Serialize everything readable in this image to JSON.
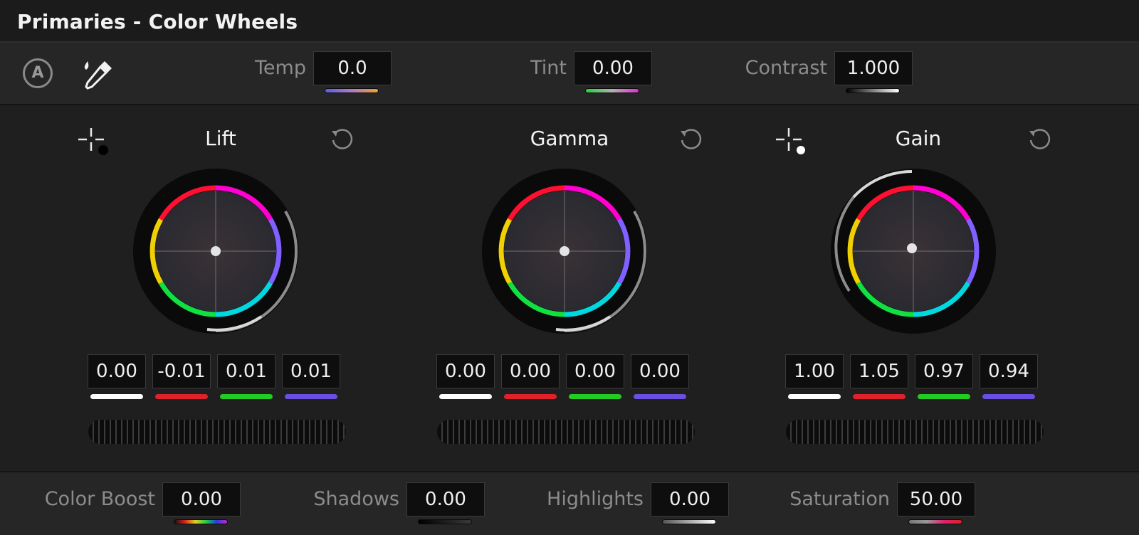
{
  "title": "Primaries - Color Wheels",
  "toolbar": {
    "auto_icon": "auto-balance-icon",
    "auto_label": "A",
    "picker_icon": "eyedropper-icon",
    "temp": {
      "label": "Temp",
      "value": "0.0"
    },
    "tint": {
      "label": "Tint",
      "value": "0.00"
    },
    "contrast": {
      "label": "Contrast",
      "value": "1.000"
    }
  },
  "wheels": [
    {
      "name": "Lift",
      "values": [
        "0.00",
        "-0.01",
        "0.01",
        "0.01"
      ]
    },
    {
      "name": "Gamma",
      "values": [
        "0.00",
        "0.00",
        "0.00",
        "0.00"
      ]
    },
    {
      "name": "Gain",
      "values": [
        "1.00",
        "1.05",
        "0.97",
        "0.94"
      ]
    }
  ],
  "channel_colors": [
    "#ffffff",
    "#e0202a",
    "#22cc22",
    "#6a4fe0"
  ],
  "bottom": {
    "color_boost": {
      "label": "Color Boost",
      "value": "0.00"
    },
    "shadows": {
      "label": "Shadows",
      "value": "0.00"
    },
    "highlights": {
      "label": "Highlights",
      "value": "0.00"
    },
    "saturation": {
      "label": "Saturation",
      "value": "50.00"
    }
  }
}
